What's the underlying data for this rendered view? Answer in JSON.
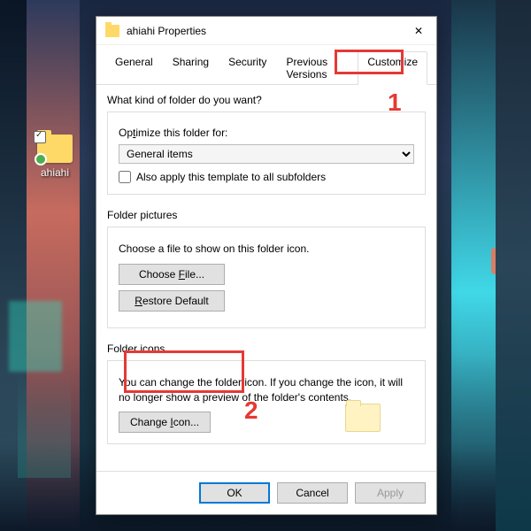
{
  "desktop": {
    "icon_label": "ahiahi"
  },
  "dialog": {
    "title": "ahiahi Properties",
    "tabs": [
      "General",
      "Sharing",
      "Security",
      "Previous Versions",
      "Customize"
    ],
    "active_tab": 4,
    "sections": {
      "kind": {
        "heading": "What kind of folder do you want?",
        "optimize_label": "Optimize this folder for:",
        "select_value": "General items",
        "apply_subfolders": "Also apply this template to all subfolders"
      },
      "pictures": {
        "heading": "Folder pictures",
        "desc": "Choose a file to show on this folder icon.",
        "choose_file": "Choose File...",
        "restore_default": "Restore Default"
      },
      "icons": {
        "heading": "Folder icons",
        "desc": "You can change the folder icon. If you change the icon, it will no longer show a preview of the folder's contents.",
        "change_icon": "Change Icon..."
      }
    },
    "buttons": {
      "ok": "OK",
      "cancel": "Cancel",
      "apply": "Apply"
    }
  },
  "annotations": {
    "n1": "1",
    "n2": "2"
  }
}
